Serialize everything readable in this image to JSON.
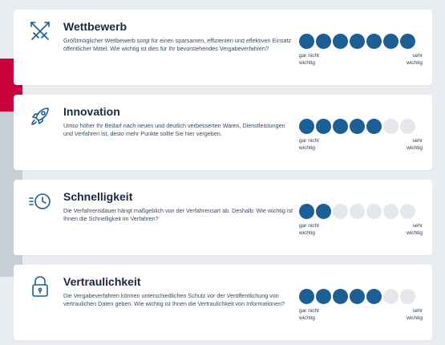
{
  "colors": {
    "accent": "#1c5e96",
    "inactive_dot": "#e4e8ed",
    "side_accent_red": "#c8003c",
    "background": "#e9edf1"
  },
  "criteria": [
    {
      "icon": "crossed-swords-icon",
      "title": "Wettbewerb",
      "description": "Größtmöglicher Wettbewerb sorgt für einen sparsamen, effizienten und effektiven Einsatz öffentlicher Mittel. Wie wichtig ist dies für Ihr bevorstehendes Vergabeverfahren?",
      "rating": 7,
      "max": 7,
      "label_low": "gar nicht wichtig",
      "label_high": "sehr wichtig"
    },
    {
      "icon": "rocket-icon",
      "title": "Innovation",
      "description": "Umso höher Ihr Bedarf nach neuen und deutlich verbesserten Waren, Dienstleistungen und Verfahren ist, desto mehr Punkte sollte Sie hier vergeben.",
      "rating": 5,
      "max": 7,
      "label_low": "gar nicht wichtig",
      "label_high": "sehr wichtig"
    },
    {
      "icon": "fast-clock-icon",
      "title": "Schnelligkeit",
      "description": "Die Verfahrensdauer hängt maßgeblich von der Verfahrensart ab. Deshalb: Wie wichtig ist Ihnen die Schnelligkeit im Verfahren?",
      "rating": 2,
      "max": 7,
      "label_low": "gar nicht wichtig",
      "label_high": "sehr wichtig"
    },
    {
      "icon": "padlock-icon",
      "title": "Vertraulichkeit",
      "description": "Die Vergabeverfahren können unterschiedlichen Schutz vor der Veröffentlichung von vertraulichen Daten geben. Wie wichtig ist Ihnen die Vertraulichkeit von Informationen?",
      "rating": 5,
      "max": 7,
      "label_low": "gar nicht wichtig",
      "label_high": "sehr wichtig"
    }
  ]
}
